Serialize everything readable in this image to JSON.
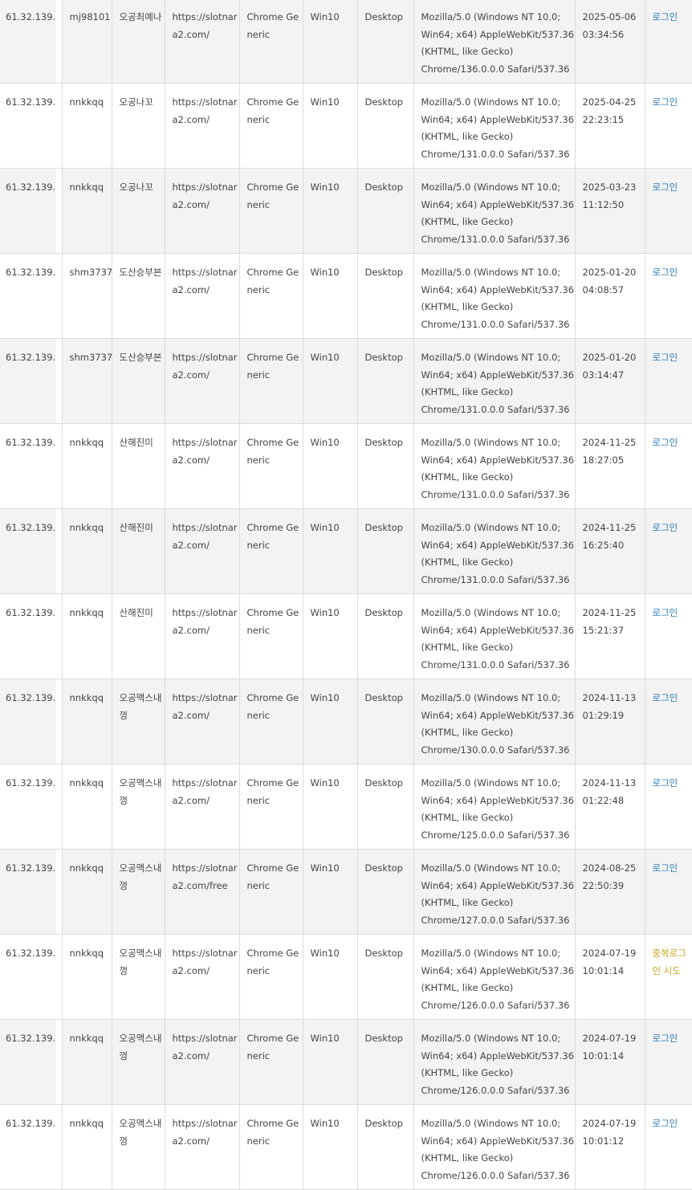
{
  "colors": {
    "row_alt_bg": "#f3f3f3",
    "login_link": "#2a7ab8",
    "duplicate_warning": "#c8a21e",
    "border": "#dcdcdc"
  },
  "rows": [
    {
      "ip": "61.32.139.",
      "user_id": "mj98101",
      "nickname": "오공최예나",
      "url": "https://slotnara2.com/",
      "browser": "Chrome Generic",
      "os": "Win10",
      "device": "Desktop",
      "ua": [
        "Mozilla/5.0 (Windows NT 10.0;",
        "Win64; x64) AppleWebKit/537.36",
        "(KHTML, like Gecko)",
        "Chrome/136.0.0.0 Safari/537.36"
      ],
      "date": "2025-05-06",
      "time": "03:34:56",
      "status": "로그인",
      "status_type": "ok"
    },
    {
      "ip": "61.32.139.",
      "user_id": "nnkkqq",
      "nickname": "오공나꼬",
      "url": "https://slotnara2.com/",
      "browser": "Chrome Generic",
      "os": "Win10",
      "device": "Desktop",
      "ua": [
        "Mozilla/5.0 (Windows NT 10.0;",
        "Win64; x64) AppleWebKit/537.36",
        "(KHTML, like Gecko)",
        "Chrome/131.0.0.0 Safari/537.36"
      ],
      "date": "2025-04-25",
      "time": "22:23:15",
      "status": "로그인",
      "status_type": "ok"
    },
    {
      "ip": "61.32.139.",
      "user_id": "nnkkqq",
      "nickname": "오공나꼬",
      "url": "https://slotnara2.com/",
      "browser": "Chrome Generic",
      "os": "Win10",
      "device": "Desktop",
      "ua": [
        "Mozilla/5.0 (Windows NT 10.0;",
        "Win64; x64) AppleWebKit/537.36",
        "(KHTML, like Gecko)",
        "Chrome/131.0.0.0 Safari/537.36"
      ],
      "date": "2025-03-23",
      "time": "11:12:50",
      "status": "로그인",
      "status_type": "ok"
    },
    {
      "ip": "61.32.139.",
      "user_id": "shm3737",
      "nickname": "도산승부본",
      "url": "https://slotnara2.com/",
      "browser": "Chrome Generic",
      "os": "Win10",
      "device": "Desktop",
      "ua": [
        "Mozilla/5.0 (Windows NT 10.0;",
        "Win64; x64) AppleWebKit/537.36",
        "(KHTML, like Gecko)",
        "Chrome/131.0.0.0 Safari/537.36"
      ],
      "date": "2025-01-20",
      "time": "04:08:57",
      "status": "로그인",
      "status_type": "ok"
    },
    {
      "ip": "61.32.139.",
      "user_id": "shm3737",
      "nickname": "도산승부본",
      "url": "https://slotnara2.com/",
      "browser": "Chrome Generic",
      "os": "Win10",
      "device": "Desktop",
      "ua": [
        "Mozilla/5.0 (Windows NT 10.0;",
        "Win64; x64) AppleWebKit/537.36",
        "(KHTML, like Gecko)",
        "Chrome/131.0.0.0 Safari/537.36"
      ],
      "date": "2025-01-20",
      "time": "03:14:47",
      "status": "로그인",
      "status_type": "ok"
    },
    {
      "ip": "61.32.139.",
      "user_id": "nnkkqq",
      "nickname": "산해진미",
      "url": "https://slotnara2.com/",
      "browser": "Chrome Generic",
      "os": "Win10",
      "device": "Desktop",
      "ua": [
        "Mozilla/5.0 (Windows NT 10.0;",
        "Win64; x64) AppleWebKit/537.36",
        "(KHTML, like Gecko)",
        "Chrome/131.0.0.0 Safari/537.36"
      ],
      "date": "2024-11-25",
      "time": "18:27:05",
      "status": "로그인",
      "status_type": "ok"
    },
    {
      "ip": "61.32.139.",
      "user_id": "nnkkqq",
      "nickname": "산해진미",
      "url": "https://slotnara2.com/",
      "browser": "Chrome Generic",
      "os": "Win10",
      "device": "Desktop",
      "ua": [
        "Mozilla/5.0 (Windows NT 10.0;",
        "Win64; x64) AppleWebKit/537.36",
        "(KHTML, like Gecko)",
        "Chrome/131.0.0.0 Safari/537.36"
      ],
      "date": "2024-11-25",
      "time": "16:25:40",
      "status": "로그인",
      "status_type": "ok"
    },
    {
      "ip": "61.32.139.",
      "user_id": "nnkkqq",
      "nickname": "산해진미",
      "url": "https://slotnara2.com/",
      "browser": "Chrome Generic",
      "os": "Win10",
      "device": "Desktop",
      "ua": [
        "Mozilla/5.0 (Windows NT 10.0;",
        "Win64; x64) AppleWebKit/537.36",
        "(KHTML, like Gecko)",
        "Chrome/131.0.0.0 Safari/537.36"
      ],
      "date": "2024-11-25",
      "time": "15:21:37",
      "status": "로그인",
      "status_type": "ok"
    },
    {
      "ip": "61.32.139.",
      "user_id": "nnkkqq",
      "nickname": "오공맥스내껑",
      "url": "https://slotnara2.com/",
      "browser": "Chrome Generic",
      "os": "Win10",
      "device": "Desktop",
      "ua": [
        "Mozilla/5.0 (Windows NT 10.0;",
        "Win64; x64) AppleWebKit/537.36",
        "(KHTML, like Gecko)",
        "Chrome/130.0.0.0 Safari/537.36"
      ],
      "date": "2024-11-13",
      "time": "01:29:19",
      "status": "로그인",
      "status_type": "ok"
    },
    {
      "ip": "61.32.139.",
      "user_id": "nnkkqq",
      "nickname": "오공맥스내껑",
      "url": "https://slotnara2.com/",
      "browser": "Chrome Generic",
      "os": "Win10",
      "device": "Desktop",
      "ua": [
        "Mozilla/5.0 (Windows NT 10.0;",
        "Win64; x64) AppleWebKit/537.36",
        "(KHTML, like Gecko)",
        "Chrome/125.0.0.0 Safari/537.36"
      ],
      "date": "2024-11-13",
      "time": "01:22:48",
      "status": "로그인",
      "status_type": "ok"
    },
    {
      "ip": "61.32.139.",
      "user_id": "nnkkqq",
      "nickname": "오공맥스내껑",
      "url": "https://slotnara2.com/free",
      "browser": "Chrome Generic",
      "os": "Win10",
      "device": "Desktop",
      "ua": [
        "Mozilla/5.0 (Windows NT 10.0;",
        "Win64; x64) AppleWebKit/537.36",
        "(KHTML, like Gecko)",
        "Chrome/127.0.0.0 Safari/537.36"
      ],
      "date": "2024-08-25",
      "time": "22:50:39",
      "status": "로그인",
      "status_type": "ok"
    },
    {
      "ip": "61.32.139.",
      "user_id": "nnkkqq",
      "nickname": "오공맥스내껑",
      "url": "https://slotnara2.com/",
      "browser": "Chrome Generic",
      "os": "Win10",
      "device": "Desktop",
      "ua": [
        "Mozilla/5.0 (Windows NT 10.0;",
        "Win64; x64) AppleWebKit/537.36",
        "(KHTML, like Gecko)",
        "Chrome/126.0.0.0 Safari/537.36"
      ],
      "date": "2024-07-19",
      "time": "10:01:14",
      "status": "중복로그인 시도",
      "status_type": "warn"
    },
    {
      "ip": "61.32.139.",
      "user_id": "nnkkqq",
      "nickname": "오공맥스내껑",
      "url": "https://slotnara2.com/",
      "browser": "Chrome Generic",
      "os": "Win10",
      "device": "Desktop",
      "ua": [
        "Mozilla/5.0 (Windows NT 10.0;",
        "Win64; x64) AppleWebKit/537.36",
        "(KHTML, like Gecko)",
        "Chrome/126.0.0.0 Safari/537.36"
      ],
      "date": "2024-07-19",
      "time": "10:01:14",
      "status": "로그인",
      "status_type": "ok"
    },
    {
      "ip": "61.32.139.",
      "user_id": "nnkkqq",
      "nickname": "오공맥스내껑",
      "url": "https://slotnara2.com/",
      "browser": "Chrome Generic",
      "os": "Win10",
      "device": "Desktop",
      "ua": [
        "Mozilla/5.0 (Windows NT 10.0;",
        "Win64; x64) AppleWebKit/537.36",
        "(KHTML, like Gecko)",
        "Chrome/126.0.0.0 Safari/537.36"
      ],
      "date": "2024-07-19",
      "time": "10:01:12",
      "status": "로그인",
      "status_type": "ok"
    }
  ]
}
